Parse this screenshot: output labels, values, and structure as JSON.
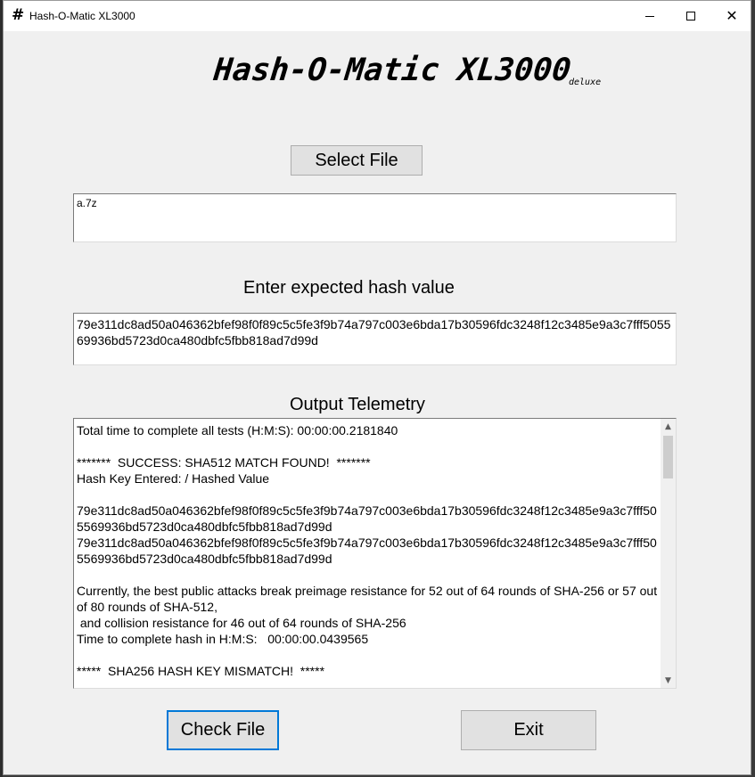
{
  "window": {
    "title": "Hash-O-Matic XL3000",
    "icon": "hash-icon",
    "icon_glyph": "#",
    "controls": {
      "minimize": "minimize-icon",
      "maximize": "maximize-icon",
      "close": "close-icon",
      "close_glyph": "✕"
    }
  },
  "header": {
    "logo": "Hash-O-Matic XL3000",
    "logo_sub": "deluxe"
  },
  "file_select": {
    "button_label": "Select File",
    "selected_file": "a.7z"
  },
  "hash_input": {
    "label": "Enter expected hash value",
    "value": "79e311dc8ad50a046362bfef98f0f89c5c5fe3f9b74a797c003e6bda17b30596fdc3248f12c3485e9a3c7fff505569936bd5723d0ca480dbfc5fbb818ad7d99d"
  },
  "output": {
    "label": "Output Telemetry",
    "text": "Total time to complete all tests (H:M:S): 00:00:00.2181840\n\n*******  SUCCESS: SHA512 MATCH FOUND!  *******\nHash Key Entered: / Hashed Value\n\n79e311dc8ad50a046362bfef98f0f89c5c5fe3f9b74a797c003e6bda17b30596fdc3248f12c3485e9a3c7fff505569936bd5723d0ca480dbfc5fbb818ad7d99d\n79e311dc8ad50a046362bfef98f0f89c5c5fe3f9b74a797c003e6bda17b30596fdc3248f12c3485e9a3c7fff505569936bd5723d0ca480dbfc5fbb818ad7d99d\n\nCurrently, the best public attacks break preimage resistance for 52 out of 64 rounds of SHA-256 or 57 out of 80 rounds of SHA-512,\n and collision resistance for 46 out of 64 rounds of SHA-256\nTime to complete hash in H:M:S:   00:00:00.0439565\n\n*****  SHA256 HASH KEY MISMATCH!  *****",
    "scroll_up_glyph": "▲",
    "scroll_down_glyph": "▼"
  },
  "actions": {
    "check_label": "Check File",
    "exit_label": "Exit"
  },
  "colors": {
    "focus_accent": "#0078d7",
    "window_bg": "#f0f0f0",
    "button_bg": "#e1e1e1"
  }
}
